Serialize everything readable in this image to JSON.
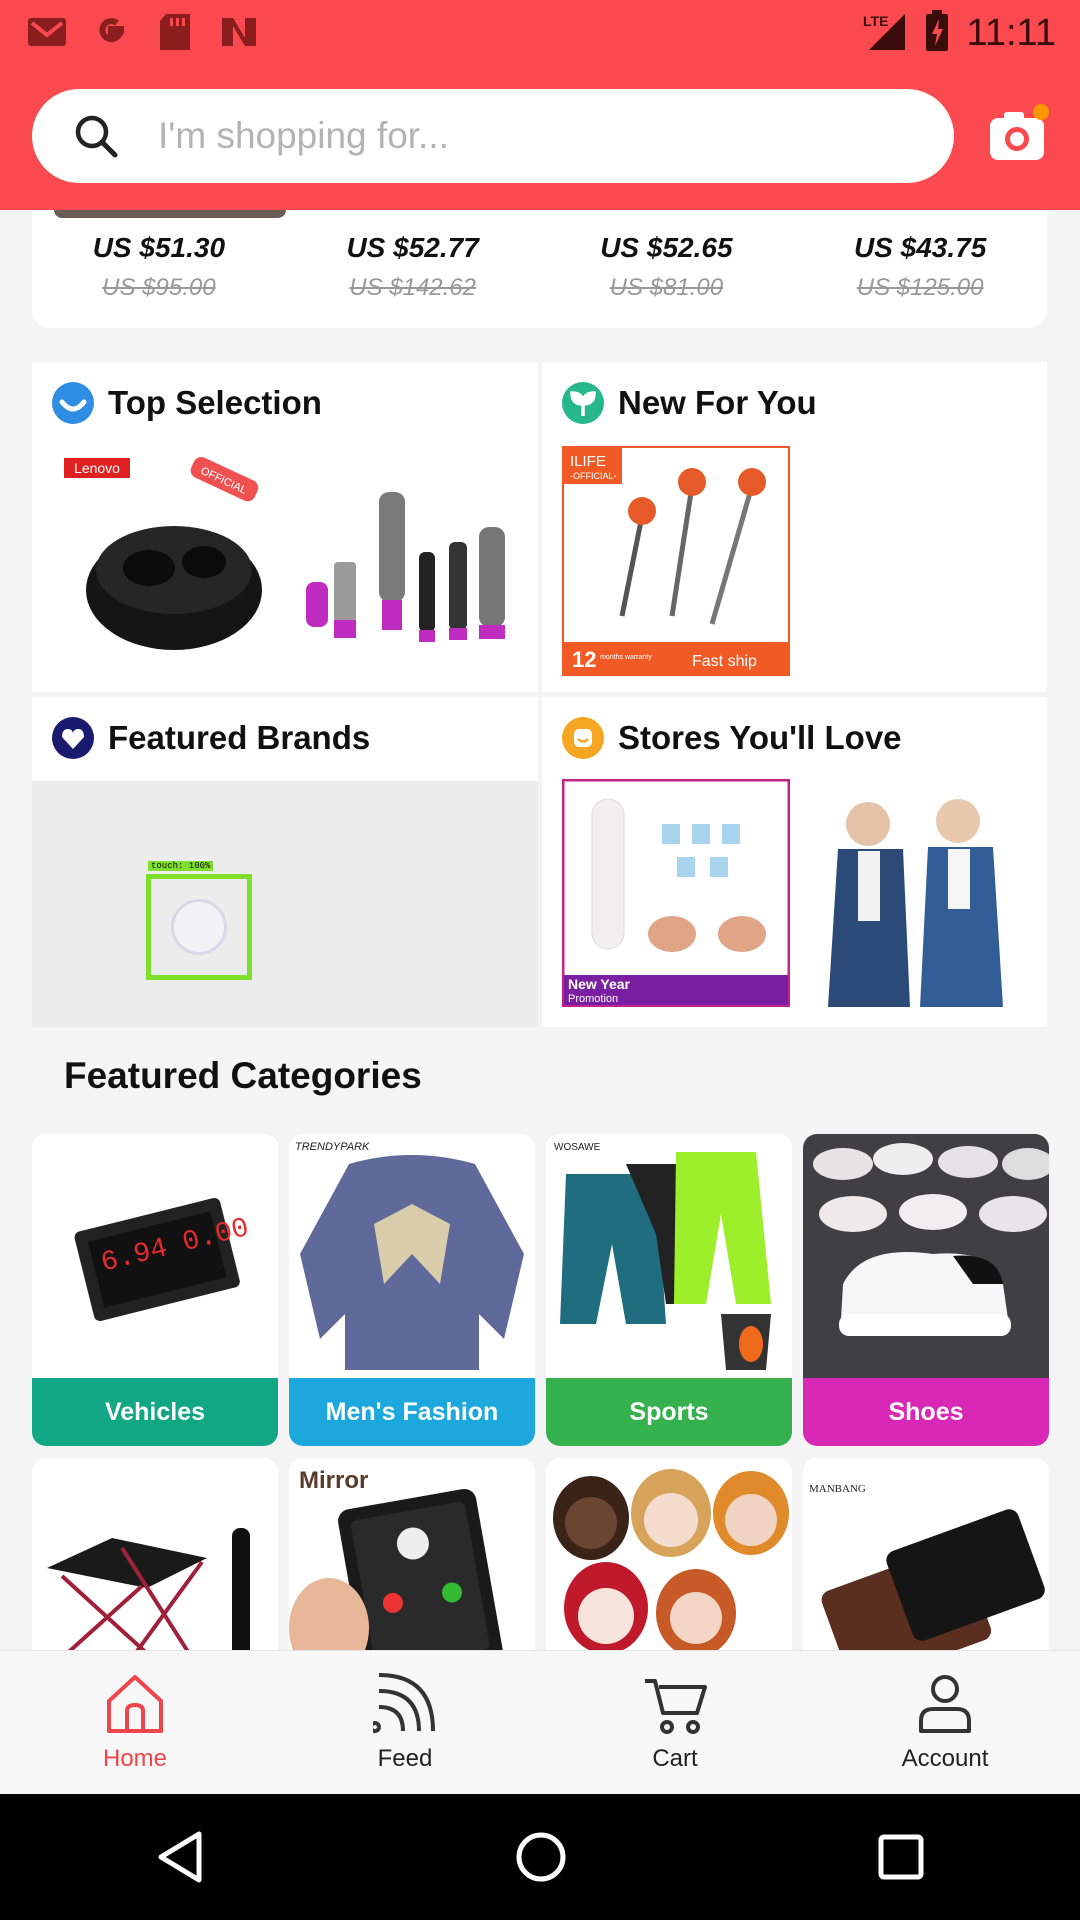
{
  "status_bar": {
    "time": "11:11",
    "network": "LTE",
    "icons": [
      "gmail-icon",
      "google-icon",
      "sd-card-icon",
      "news-icon",
      "signal-icon",
      "battery-icon"
    ]
  },
  "search": {
    "placeholder": "I'm shopping for..."
  },
  "prices": [
    {
      "now": "US $51.30",
      "old": "US $95.00"
    },
    {
      "now": "US $52.77",
      "old": "US $142.62"
    },
    {
      "now": "US $52.65",
      "old": "US $81.00"
    },
    {
      "now": "US $43.75",
      "old": "US $125.00"
    }
  ],
  "tiles": {
    "top_selection": {
      "title": "Top Selection",
      "badges": [
        "Lenovo",
        "OFFICIAL"
      ]
    },
    "new_for_you": {
      "title": "New For You",
      "badges": [
        "ILIFE",
        "-OFFICIAL-",
        "12",
        "months warranty",
        "Fast ship"
      ]
    },
    "featured_brands": {
      "title": "Featured Brands",
      "touch_label": "touch: 100%"
    },
    "stores": {
      "title": "Stores You'll Love",
      "badges": [
        "New Year",
        "Promotion"
      ]
    }
  },
  "featured_categories": {
    "title": "Featured Categories",
    "items": [
      {
        "label": "Vehicles",
        "color": "#11a684",
        "img_text": "6.94 0.00"
      },
      {
        "label": "Men's Fashion",
        "color": "#1ca7dd",
        "img_text": "TRENDYPARK"
      },
      {
        "label": "Sports",
        "color": "#35b24e",
        "img_text": "WOSAWE"
      },
      {
        "label": "Shoes",
        "color": "#d928b5",
        "img_text": ""
      }
    ],
    "row2": [
      {
        "img_text": ""
      },
      {
        "img_text": "Mirror"
      },
      {
        "img_text": ""
      },
      {
        "img_text": "MANBANG"
      }
    ]
  },
  "bottom_nav": [
    {
      "label": "Home",
      "icon": "home-icon",
      "active": true
    },
    {
      "label": "Feed",
      "icon": "feed-icon",
      "active": false
    },
    {
      "label": "Cart",
      "icon": "cart-icon",
      "active": false
    },
    {
      "label": "Account",
      "icon": "account-icon",
      "active": false
    }
  ],
  "colors": {
    "brand": "#fb4a4f",
    "active_nav": "#f0454b"
  }
}
